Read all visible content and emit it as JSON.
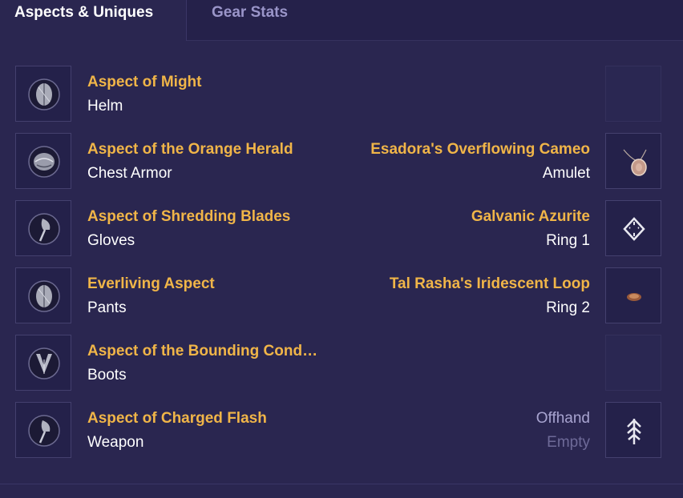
{
  "tabs": [
    {
      "label": "Aspects & Uniques",
      "active": true
    },
    {
      "label": "Gear Stats",
      "active": false
    }
  ],
  "aspects": [
    {
      "name": "Aspect of Might",
      "slot": "Helm",
      "icon": "helm-aspect-icon"
    },
    {
      "name": "Aspect of the Orange Herald",
      "slot": "Chest Armor",
      "icon": "chest-aspect-icon"
    },
    {
      "name": "Aspect of Shredding Blades",
      "slot": "Gloves",
      "icon": "gloves-aspect-icon"
    },
    {
      "name": "Everliving Aspect",
      "slot": "Pants",
      "icon": "pants-aspect-icon"
    },
    {
      "name": "Aspect of the Bounding Cond…",
      "slot": "Boots",
      "icon": "boots-aspect-icon"
    },
    {
      "name": "Aspect of Charged Flash",
      "slot": "Weapon",
      "icon": "weapon-aspect-icon"
    }
  ],
  "uniques": [
    {
      "name": "Esadora's Overflowing Cameo",
      "slot": "Amulet",
      "icon": "amulet-icon"
    },
    {
      "name": "Galvanic Azurite",
      "slot": "Ring 1",
      "icon": "ring-rune-icon"
    },
    {
      "name": "Tal Rasha's Iridescent Loop",
      "slot": "Ring 2",
      "icon": "ring-loop-icon"
    },
    {
      "name": "Offhand",
      "slot": "Empty",
      "icon": "offhand-glyph-icon"
    }
  ],
  "colors": {
    "background": "#2a2650",
    "accent_gold": "#f0b548",
    "text_white": "#ffffff",
    "muted": "#a8a4d0"
  }
}
